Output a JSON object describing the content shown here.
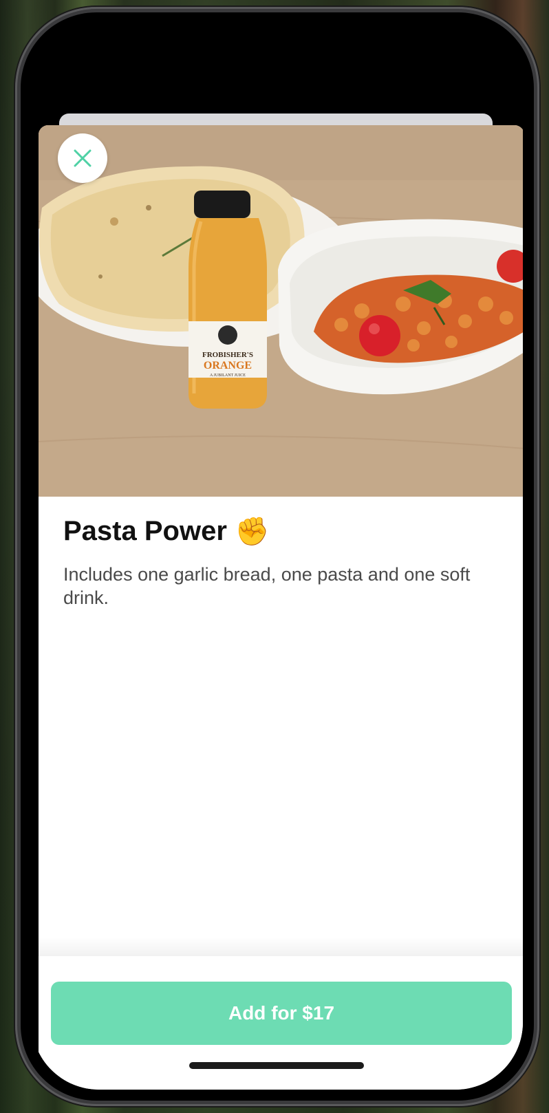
{
  "product": {
    "title": "Pasta Power",
    "emoji": "✊",
    "description": "Includes one garlic bread, one pasta and one soft drink."
  },
  "hero": {
    "bottle_label_top": "FROBISHER'S",
    "bottle_label_main": "ORANGE",
    "bottle_label_sub": "A JUBILANT JUICE"
  },
  "actions": {
    "add_label": "Add for $17"
  },
  "colors": {
    "accent": "#6ddcb3",
    "close_icon": "#4fd1a5"
  }
}
